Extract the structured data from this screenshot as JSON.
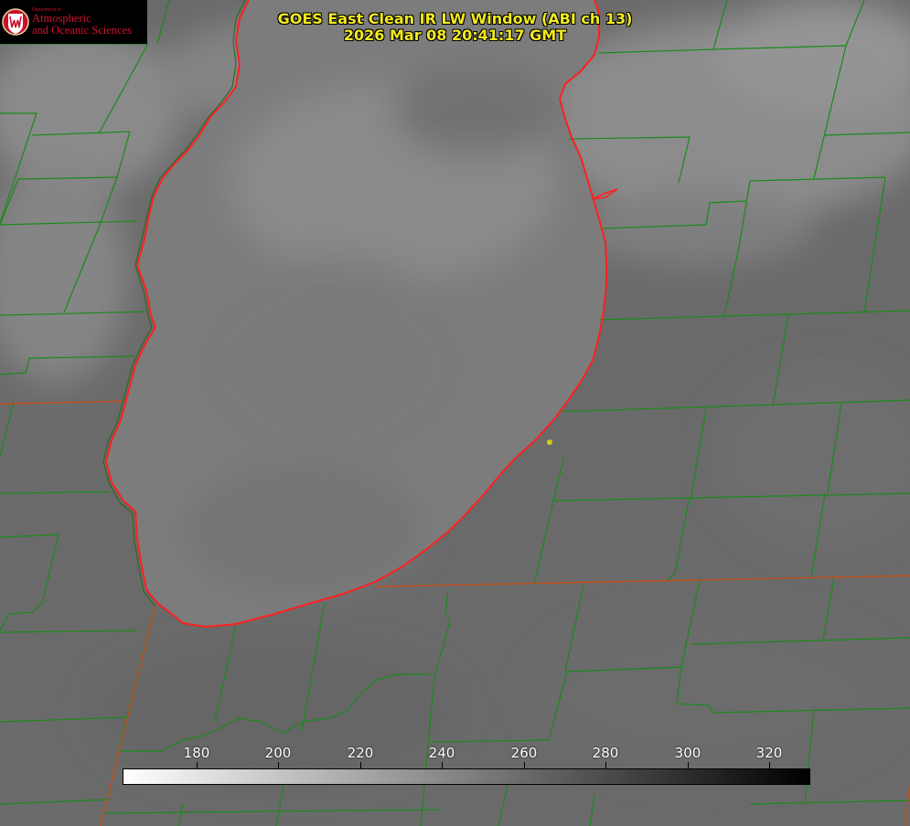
{
  "title": {
    "line1": "GOES East Clean IR LW Window (ABI ch 13)",
    "line2": "2026 Mar 08 20:41:17 GMT"
  },
  "logo": {
    "department": "Department of",
    "line1": "Atmospheric",
    "line2": "and Oceanic Sciences"
  },
  "colorbar": {
    "ticks": [
      "180",
      "200",
      "220",
      "240",
      "260",
      "280",
      "300",
      "320"
    ],
    "gradient_start": "#ffffff",
    "gradient_end": "#000000"
  },
  "colors": {
    "title_text": "#f2ea1f",
    "county_lines": "#1a8a1a",
    "state_lines": "#c0501a",
    "shoreline": "#ff2020",
    "logo_red": "#c8102e",
    "marker": "#d4c81a"
  },
  "map": {
    "feature": "lake",
    "overlay": [
      "county-boundaries",
      "state-boundaries",
      "coastline"
    ]
  }
}
